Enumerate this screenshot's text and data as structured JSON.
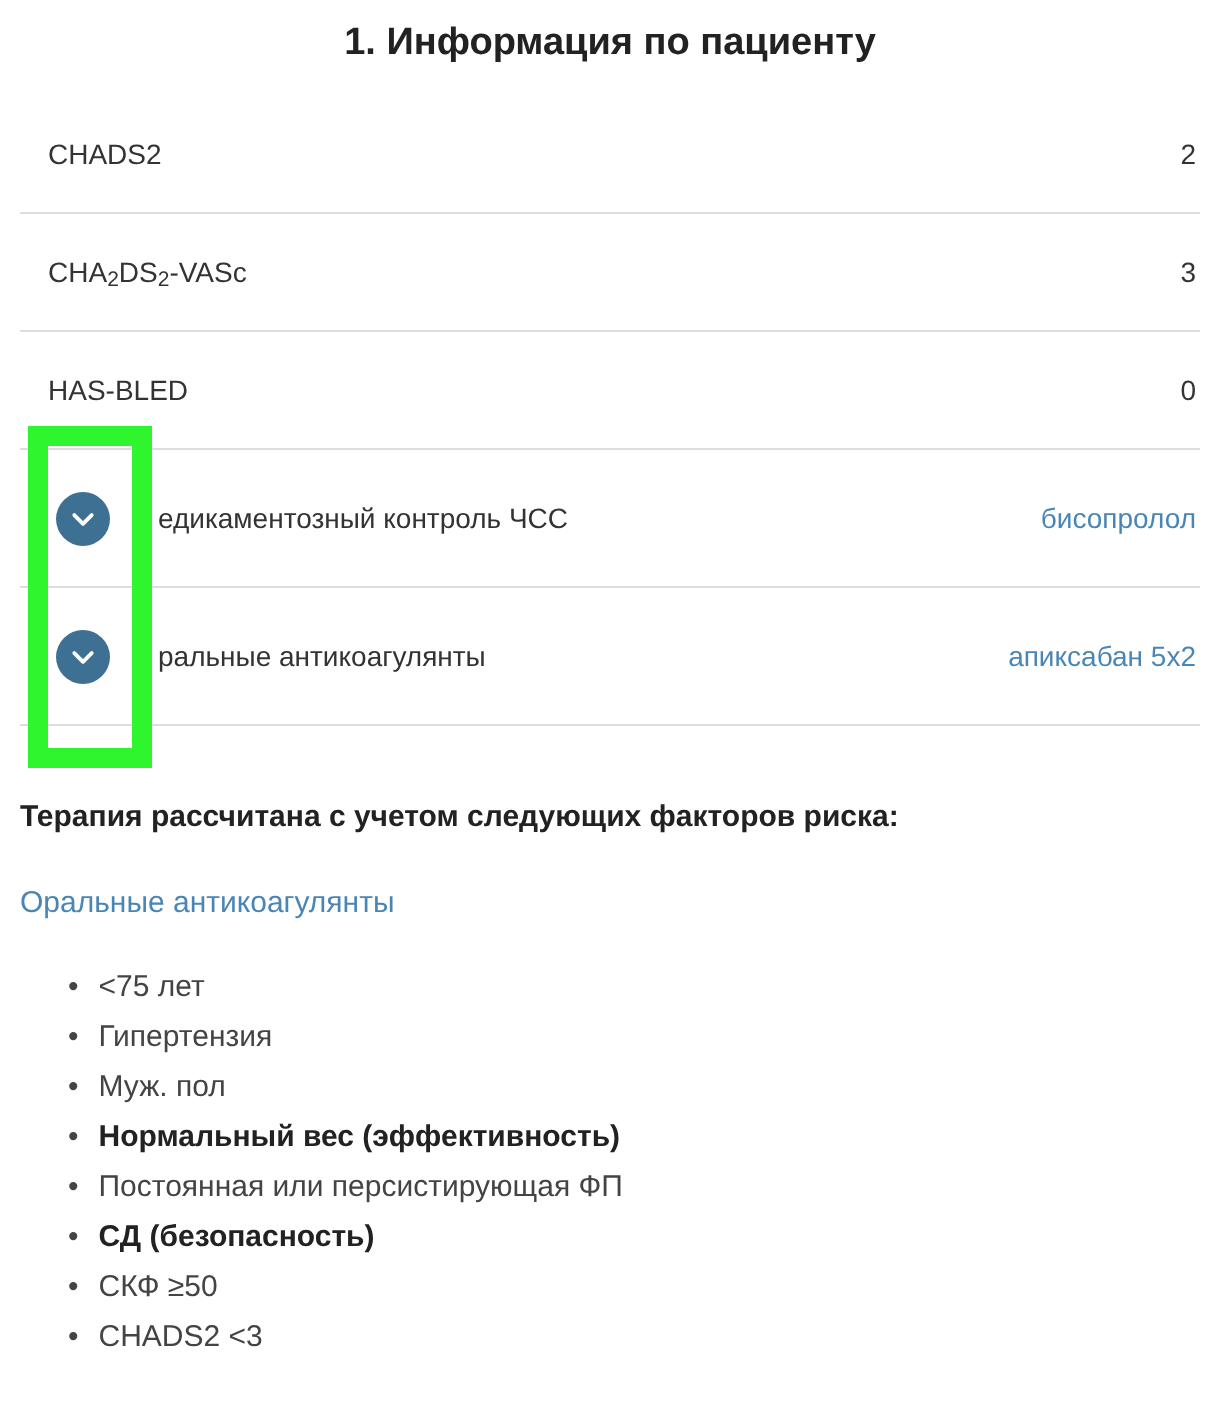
{
  "title": "1. Информация по пациенту",
  "scores": [
    {
      "label": "CHADS2",
      "value": "2"
    },
    {
      "label": "CHA$_{2}$DS$_{2}$-VASc",
      "value": "3"
    },
    {
      "label": "HAS-BLED",
      "value": "0"
    }
  ],
  "therapies": [
    {
      "label": "едикаментозный контроль ЧСС",
      "value": "бисопролол",
      "expanded": false
    },
    {
      "label": "ральные антикоагулянты",
      "value": "апиксабан 5x2",
      "expanded": false
    }
  ],
  "factors_heading": "Терапия рассчитана с учетом следующих факторов риска:",
  "factors_group": "Оральные антикоагулянты",
  "factors": [
    {
      "text": "<75 лет",
      "bold": false
    },
    {
      "text": "Гипертензия",
      "bold": false
    },
    {
      "text": "Муж. пол",
      "bold": false
    },
    {
      "text": "Нормальный вес (эффективность)",
      "bold": true
    },
    {
      "text": "Постоянная или персистирующая ФП",
      "bold": false
    },
    {
      "text": "СД (безопасность)",
      "bold": true
    },
    {
      "text": "СКФ ≥50",
      "bold": false
    },
    {
      "text": "CHADS2 <3",
      "bold": false
    }
  ],
  "bullet": "•",
  "highlight": {
    "color": "#2ef52e"
  }
}
